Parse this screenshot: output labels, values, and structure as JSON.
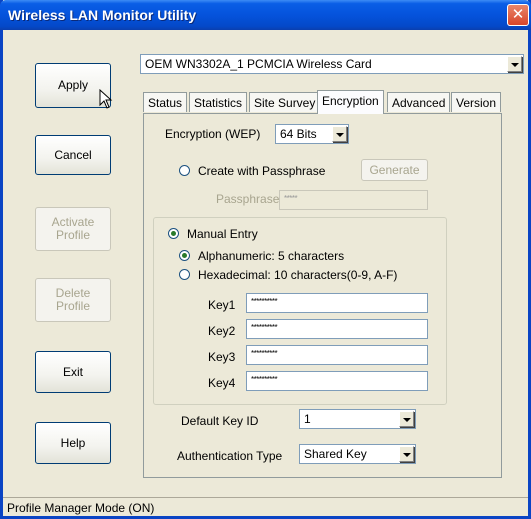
{
  "window": {
    "title": "Wireless LAN Monitor Utility",
    "close_glyph": "✕"
  },
  "left_buttons": {
    "apply": "Apply",
    "cancel": "Cancel",
    "activate_profile_line1": "Activate",
    "activate_profile_line2": "Profile",
    "delete_profile_line1": "Delete",
    "delete_profile_line2": "Profile",
    "exit": "Exit",
    "help": "Help"
  },
  "adapter_select": {
    "value": "OEM WN3302A_1 PCMCIA Wireless Card"
  },
  "tabs": [
    {
      "label": "Status"
    },
    {
      "label": "Statistics"
    },
    {
      "label": "Site Survey"
    },
    {
      "label": "Encryption",
      "active": true
    },
    {
      "label": "Advanced"
    },
    {
      "label": "Version"
    }
  ],
  "encryption": {
    "wep_label": "Encryption (WEP)",
    "wep_value": "64 Bits",
    "passphrase_radio": "Create with Passphrase",
    "generate_button": "Generate",
    "passphrase_label": "Passphrase",
    "passphrase_value": "*****",
    "manual_entry": "Manual Entry",
    "alphanumeric": "Alphanumeric: 5 characters",
    "hexadecimal": "Hexadecimal: 10 characters(0-9, A-F)",
    "keys": [
      {
        "label": "Key1",
        "value": "**********"
      },
      {
        "label": "Key2",
        "value": "**********"
      },
      {
        "label": "Key3",
        "value": "**********"
      },
      {
        "label": "Key4",
        "value": "**********"
      }
    ],
    "default_key_label": "Default Key ID",
    "default_key_value": "1",
    "auth_label": "Authentication Type",
    "auth_value": "Shared Key"
  },
  "status_bar": {
    "text": "Profile Manager Mode (ON)"
  },
  "colors": {
    "title_bar": "#0553dc",
    "window_bg": "#ece9d8",
    "close_button": "#d8452a"
  }
}
